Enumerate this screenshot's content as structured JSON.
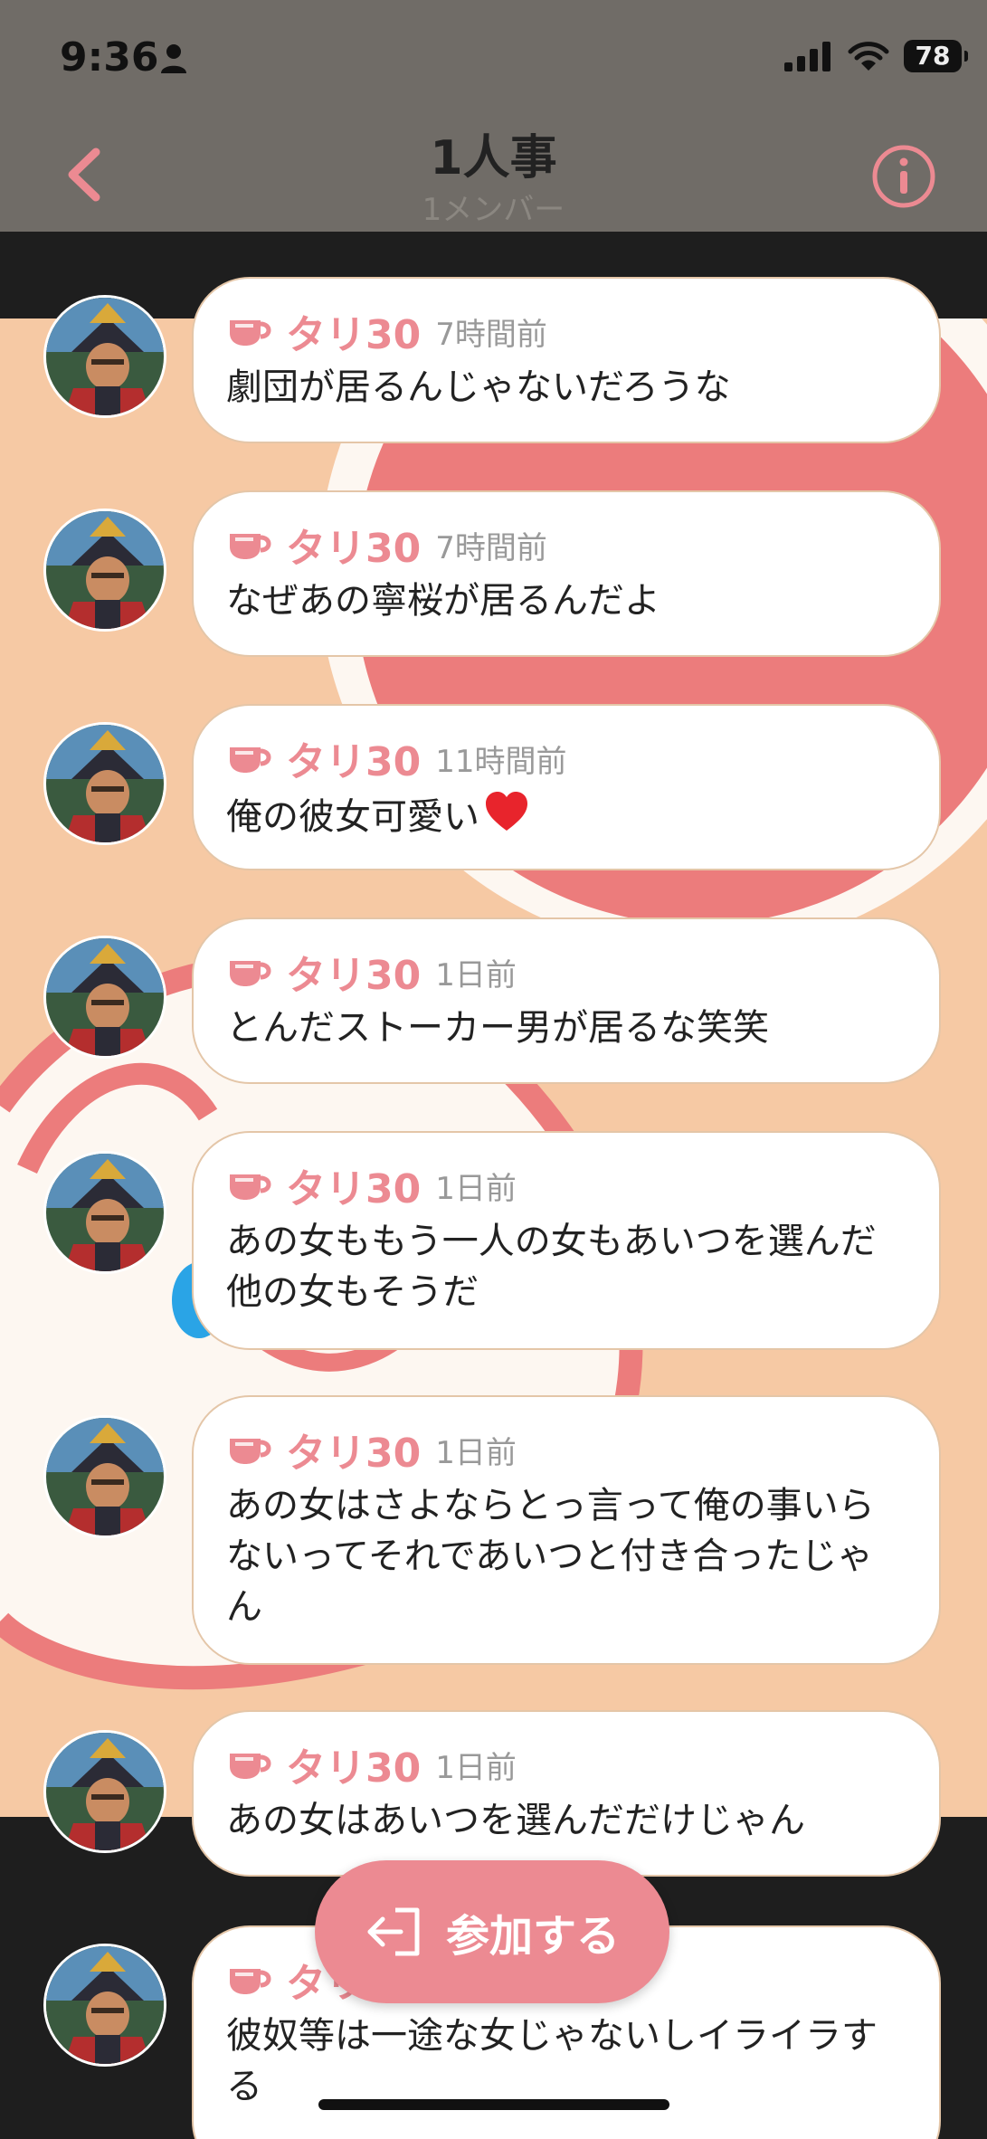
{
  "status": {
    "time": "9:36",
    "battery": "78"
  },
  "header": {
    "title": "1人事",
    "subtitle": "1メンバー"
  },
  "messages": [
    {
      "name": "タリ30",
      "time": "7時間前",
      "text": "劇団が居るんじゃないだろうな"
    },
    {
      "name": "タリ30",
      "time": "7時間前",
      "text": "なぜあの寧桜が居るんだよ"
    },
    {
      "name": "タリ30",
      "time": "11時間前",
      "text": "俺の彼女可愛い"
    },
    {
      "name": "タリ30",
      "time": "1日前",
      "text": "とんだストーカー男が居るな笑笑"
    },
    {
      "name": "タリ30",
      "time": "1日前",
      "text": "あの女ももう一人の女もあいつを選んだ他の女もそうだ"
    },
    {
      "name": "タリ30",
      "time": "1日前",
      "text": "あの女はさよならとっ言って俺の事いらないってそれであいつと付き合ったじゃん"
    },
    {
      "name": "タリ30",
      "time": "1日前",
      "text": "あの女はあいつを選んだだけじゃん"
    },
    {
      "name": "タリ30",
      "time": "",
      "text": "彼奴等は一途な女じゃないしイライラする"
    }
  ],
  "join": {
    "label": "参加する"
  },
  "colors": {
    "accent": "#ec8a92",
    "header_bg": "#706c67",
    "chat_bg": "#f6c9a4"
  },
  "icons": {
    "back": "chevron-left-icon",
    "info": "info-circle-icon",
    "cup": "cup-icon",
    "join": "enter-icon"
  }
}
